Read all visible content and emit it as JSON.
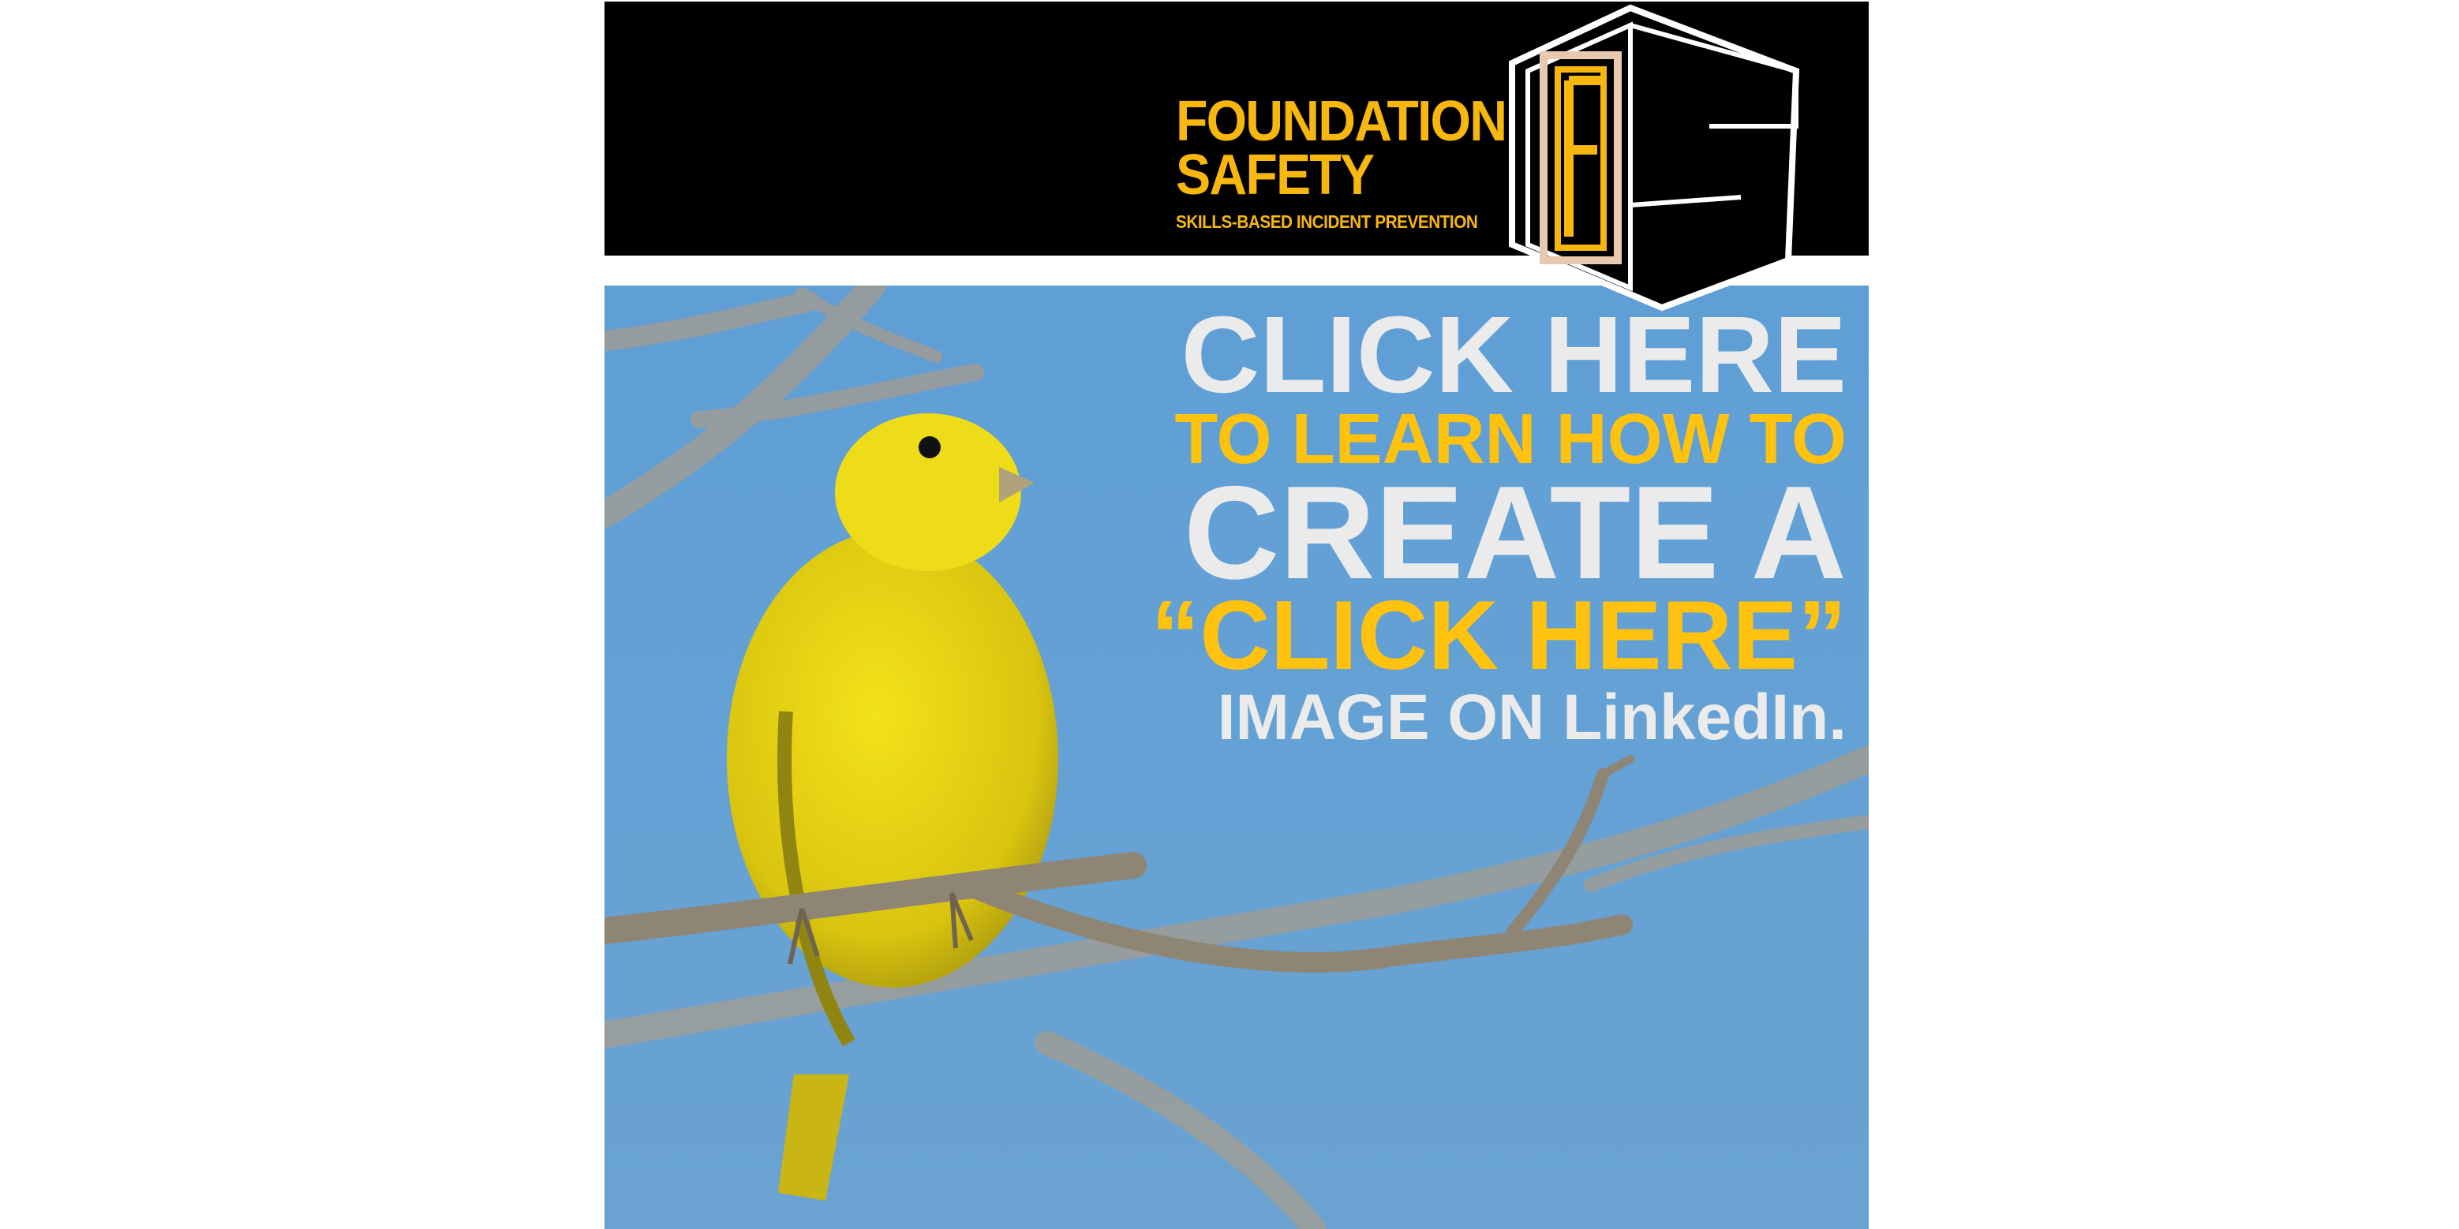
{
  "brand": {
    "line1": "FOUNDATION",
    "line2": "SAFETY",
    "tagline": "SKILLS-BASED INCIDENT PREVENTION",
    "logo_icon": "fs-monogram-logo",
    "color": "#f8b70f"
  },
  "headline": {
    "line1": "CLICK HERE",
    "line2": "TO LEARN HOW TO",
    "line3": "CREATE A",
    "line4": "“CLICK HERE”",
    "line5": "IMAGE ON LinkedIn."
  },
  "photo": {
    "subject": "yellow-bird-on-branch",
    "sky_color": "#62a0d4"
  },
  "colors": {
    "header_bg": "#000000",
    "headline_light": "#ebebeb",
    "headline_accent": "#ffc20e"
  }
}
